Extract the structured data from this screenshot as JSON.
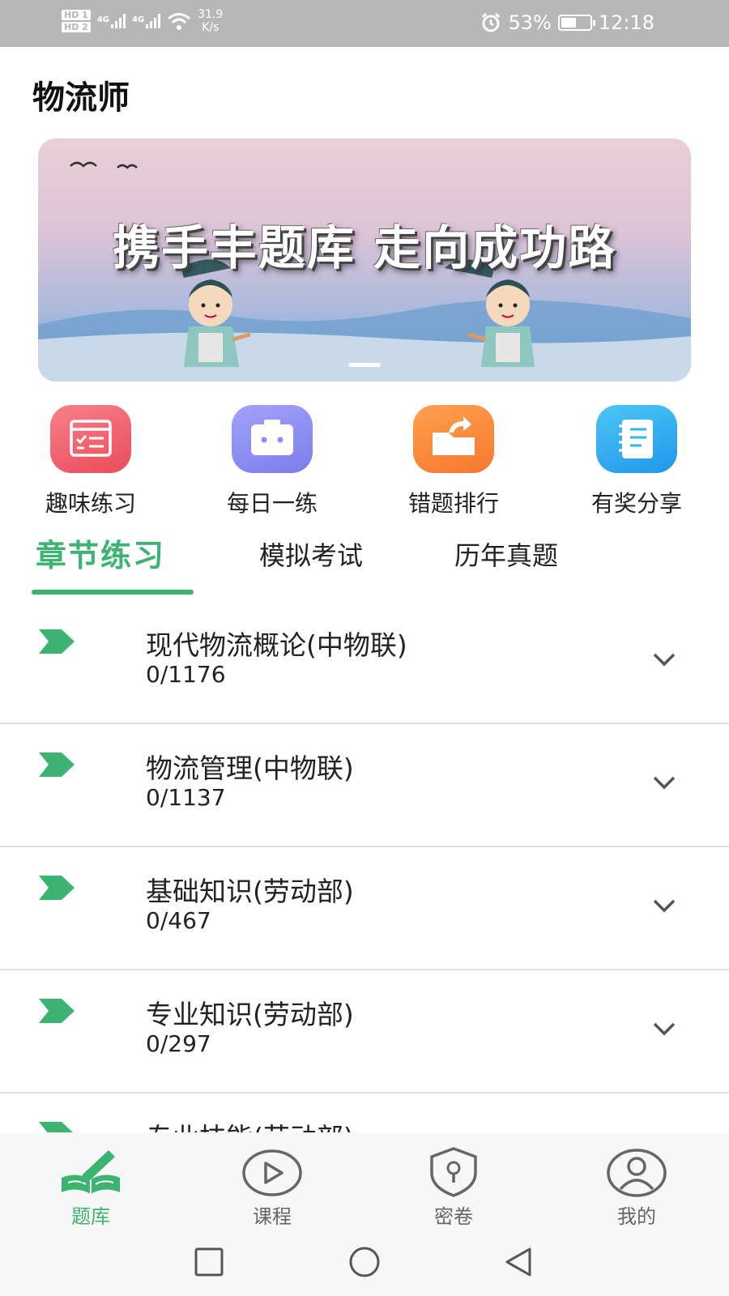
{
  "status_bar": {
    "hd_badges": [
      "HD 1",
      "HD 2"
    ],
    "network_labels": [
      "4G",
      "4G"
    ],
    "net_speed_value": "31.9",
    "net_speed_unit": "K/s",
    "battery_percent": "53%",
    "battery_level": 0.53,
    "time": "12:18"
  },
  "app": {
    "title": "物流师"
  },
  "banner": {
    "caption": "携手丰题库  走向成功路",
    "indicator_count": 1,
    "active_index": 0
  },
  "quick_actions": [
    {
      "label": "趣味练习",
      "icon": "checklist-icon",
      "color": "#f0606a"
    },
    {
      "label": "每日一练",
      "icon": "briefcase-icon",
      "color": "#8c8cf2"
    },
    {
      "label": "错题排行",
      "icon": "folder-share-icon",
      "color": "#fb8a3c"
    },
    {
      "label": "有奖分享",
      "icon": "notebook-icon",
      "color": "#32b4f0"
    }
  ],
  "tabs": [
    {
      "label": "章节练习",
      "active": true
    },
    {
      "label": "模拟考试",
      "active": false
    },
    {
      "label": "历年真题",
      "active": false
    }
  ],
  "chapters": [
    {
      "title": "现代物流概论(中物联)",
      "count": "0/1176"
    },
    {
      "title": "物流管理(中物联)",
      "count": "0/1137"
    },
    {
      "title": "基础知识(劳动部)",
      "count": "0/467"
    },
    {
      "title": "专业知识(劳动部)",
      "count": "0/297"
    },
    {
      "title": "专业技能(劳动部)",
      "count": ""
    }
  ],
  "bottom_nav": [
    {
      "label": "题库",
      "icon": "book-pen-icon",
      "active": true
    },
    {
      "label": "课程",
      "icon": "play-circle-icon",
      "active": false
    },
    {
      "label": "密卷",
      "icon": "shield-lock-icon",
      "active": false
    },
    {
      "label": "我的",
      "icon": "user-circle-icon",
      "active": false
    }
  ],
  "colors": {
    "accent": "#3cb371",
    "status_bar": "#b7b7b7",
    "divider": "#e2e2e2",
    "inactive_nav": "#666666"
  }
}
